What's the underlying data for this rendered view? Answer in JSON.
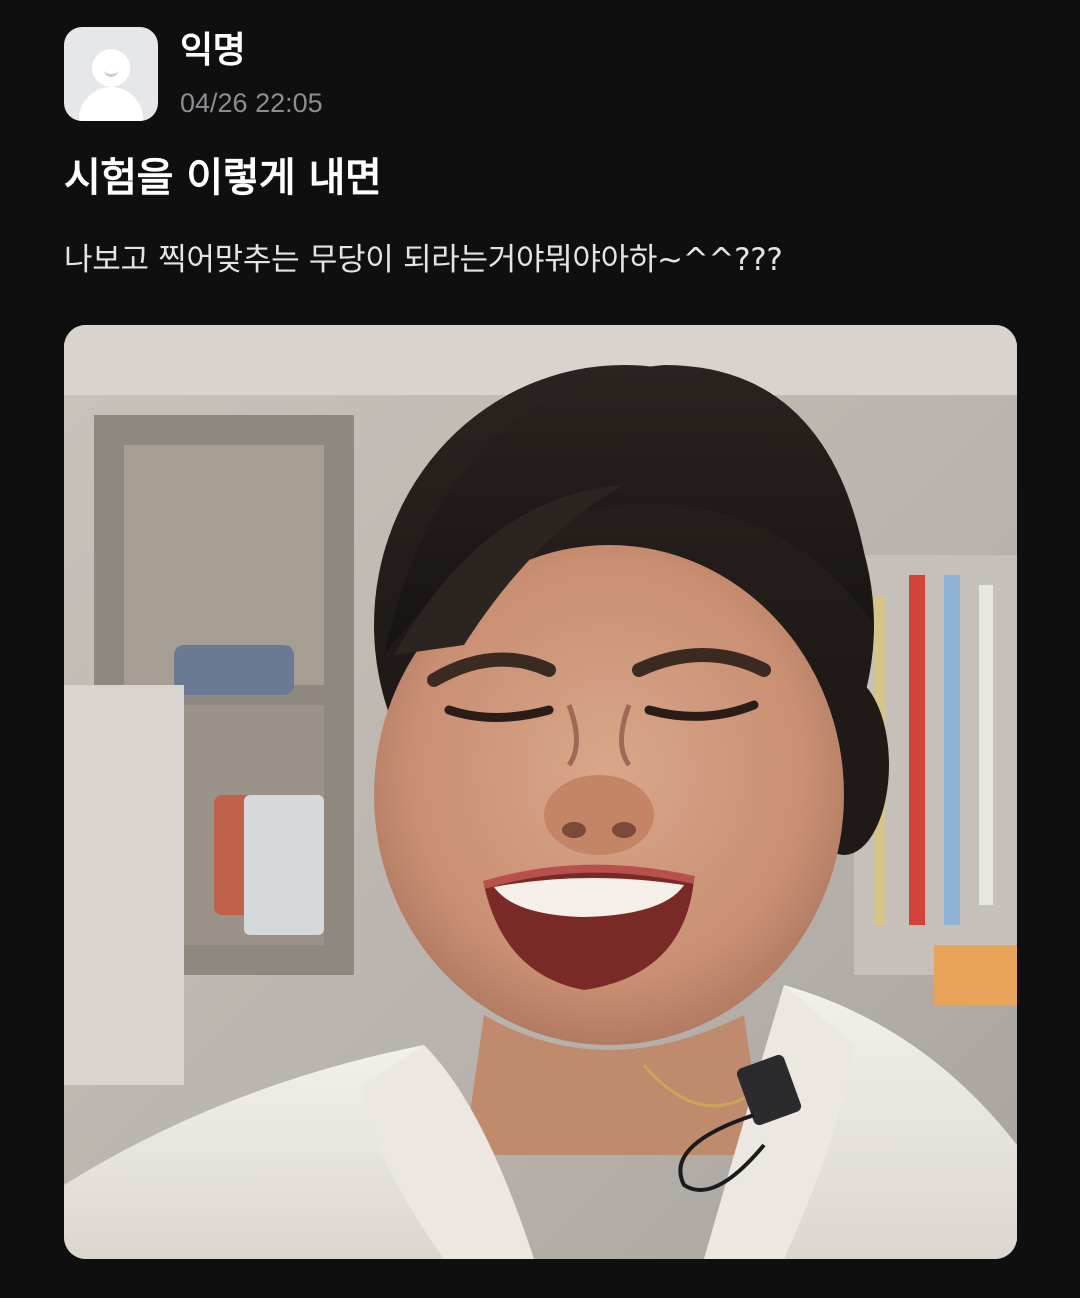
{
  "post": {
    "author": "익명",
    "timestamp": "04/26 22:05",
    "title": "시험을 이렇게 내면",
    "content": "나보고 찍어맞추는 무당이 되라는거야뭐야아하~^^???",
    "avatar_icon": "anonymous-user-icon",
    "image": {
      "description_icon": "photo-image"
    }
  },
  "colors": {
    "background": "#0f0f10",
    "text_primary": "#ffffff",
    "text_secondary": "#8d8d92",
    "avatar_bg": "#e6e7ea"
  }
}
